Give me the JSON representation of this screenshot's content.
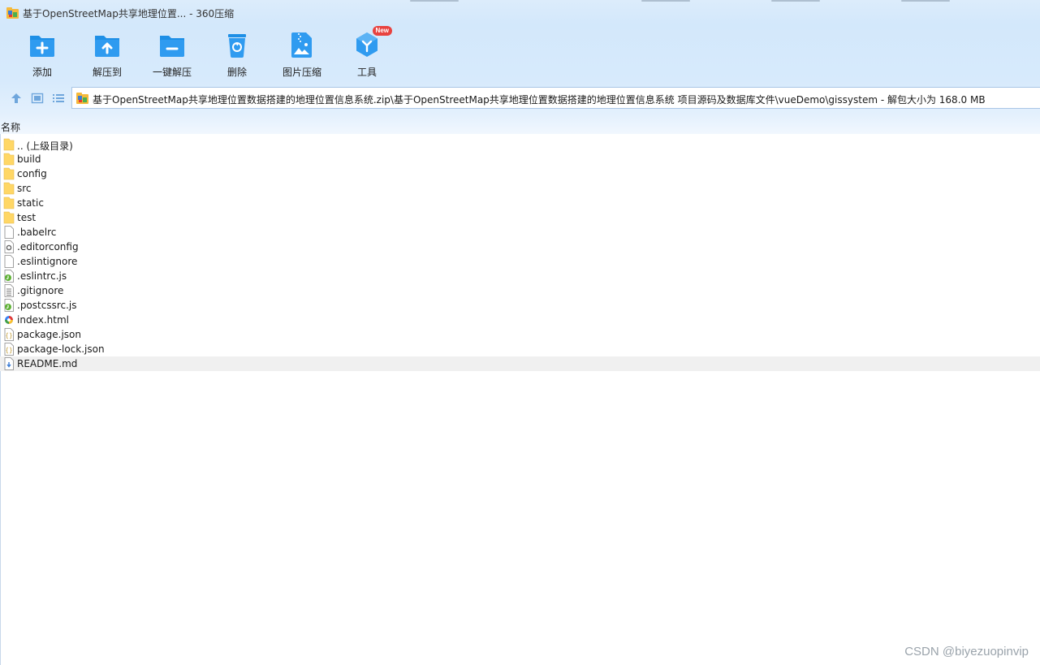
{
  "window": {
    "title": "基于OpenStreetMap共享地理位置... - 360压缩"
  },
  "toolbar": {
    "items": [
      {
        "label": "添加",
        "icon": "add-folder-icon"
      },
      {
        "label": "解压到",
        "icon": "extract-to-icon"
      },
      {
        "label": "一键解压",
        "icon": "one-click-extract-icon"
      },
      {
        "label": "删除",
        "icon": "delete-icon"
      },
      {
        "label": "图片压缩",
        "icon": "image-compress-icon"
      },
      {
        "label": "工具",
        "icon": "tools-icon",
        "badge": "New"
      }
    ]
  },
  "address": {
    "path": "基于OpenStreetMap共享地理位置数据搭建的地理位置信息系统.zip\\基于OpenStreetMap共享地理位置数据搭建的地理位置信息系统 项目源码及数据库文件\\vueDemo\\gissystem - 解包大小为 168.0 MB"
  },
  "list": {
    "column_name": "名称",
    "files": [
      {
        "name": ".. (上级目录)",
        "type": "folder"
      },
      {
        "name": "build",
        "type": "folder"
      },
      {
        "name": "config",
        "type": "folder"
      },
      {
        "name": "src",
        "type": "folder"
      },
      {
        "name": "static",
        "type": "folder"
      },
      {
        "name": "test",
        "type": "folder"
      },
      {
        "name": ".babelrc",
        "type": "file"
      },
      {
        "name": ".editorconfig",
        "type": "config"
      },
      {
        "name": ".eslintignore",
        "type": "file"
      },
      {
        "name": ".eslintrc.js",
        "type": "js"
      },
      {
        "name": ".gitignore",
        "type": "text"
      },
      {
        "name": ".postcssrc.js",
        "type": "js"
      },
      {
        "name": "index.html",
        "type": "html"
      },
      {
        "name": "package.json",
        "type": "json"
      },
      {
        "name": "package-lock.json",
        "type": "json"
      },
      {
        "name": "README.md",
        "type": "md",
        "selected": true
      }
    ]
  },
  "watermark": "CSDN @biyezuopinvip",
  "colors": {
    "accent": "#1e8fe6",
    "folder": "#ffd766",
    "badge": "#e8423f",
    "selected_row": "#f0f0f0"
  }
}
